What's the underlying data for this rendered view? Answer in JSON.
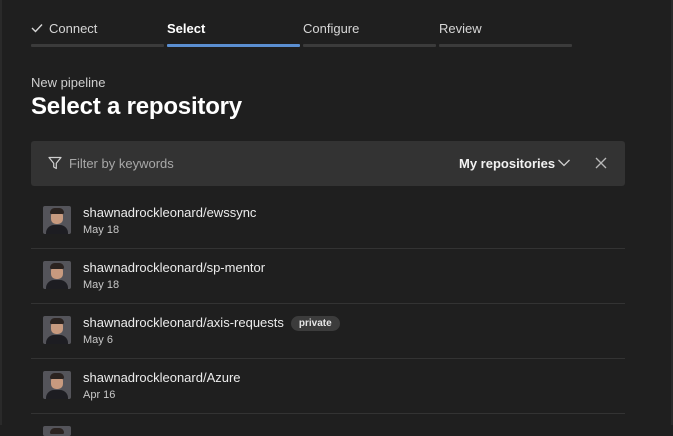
{
  "wizard": {
    "steps": [
      {
        "label": "Connect",
        "completed": true
      },
      {
        "label": "Select",
        "active": true
      },
      {
        "label": "Configure"
      },
      {
        "label": "Review"
      }
    ]
  },
  "header": {
    "subtitle": "New pipeline",
    "title": "Select a repository"
  },
  "filter": {
    "placeholder": "Filter by keywords",
    "scope": "My repositories"
  },
  "repositories": [
    {
      "name": "shawnadrockleonard/ewssync",
      "date": "May 18",
      "badge": ""
    },
    {
      "name": "shawnadrockleonard/sp-mentor",
      "date": "May 18",
      "badge": ""
    },
    {
      "name": "shawnadrockleonard/axis-requests",
      "date": "May 6",
      "badge": "private"
    },
    {
      "name": "shawnadrockleonard/Azure",
      "date": "Apr 16",
      "badge": ""
    }
  ],
  "colors": {
    "background": "#1f1f1f",
    "accent": "#5b8fd1",
    "filter_bar": "#333333"
  }
}
